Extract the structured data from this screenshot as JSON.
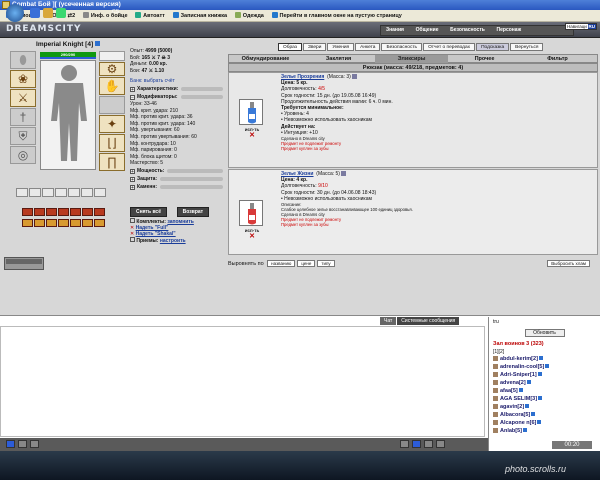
{
  "window": {
    "title": "Combat Бой ][ (усеченная версия)"
  },
  "toolbar": {
    "items": [
      "Помощь",
      "Окно ⇄2",
      "Инф. о бойце",
      "Автоатт",
      "Записная книжка",
      "Одежда",
      "Перейти в главном окне на пустую страницу"
    ]
  },
  "brand": {
    "logo": "DREAMSCITY"
  },
  "topnav": {
    "row1": [
      "Знания",
      "Общение",
      "Безопасность",
      "Персонаж"
    ],
    "row2": [
      "Инвентарь",
      "Умения",
      "Отчет о переводах",
      "Подсвенки",
      "Навигация"
    ],
    "nav_label": "Навигаци",
    "nav_value": "RU"
  },
  "character": {
    "name": "Imperial Knight",
    "level": "[4]",
    "hp": "290/290"
  },
  "stats": {
    "lines": [
      {
        "k": "Опыт:",
        "v": "4999 (5000)"
      },
      {
        "k": "Бой:",
        "v": "165 ⚔ 7 ☠ 3"
      },
      {
        "k": "Деньги:",
        "v": "0.00 кр."
      },
      {
        "k": "Бои:",
        "v": "47 ⚔ 1.10"
      }
    ],
    "bank": "Банк: выбрать счёт",
    "char_section": "Характеристики:",
    "mod_section": "Модификаторы:",
    "mods": [
      "Урон: 33-46",
      "Мф. крит. удара: 210",
      "Мф. против крит. удара: 36",
      "Мф. против крит. удара: 140",
      "Мф. увертывания: 60",
      "Мф. против увертывания: 60",
      "Мф. контрудара: 10",
      "Мф. парирования: 0",
      "Мф. блока щитом: 0",
      "Мастерство: 5"
    ],
    "sections2": [
      "Мощность:",
      "Защита:",
      "Каменн:"
    ],
    "btn_remove": "Снять всё",
    "btn_return": "Возврат",
    "comp_label": "Комплекты:",
    "comp_link": "запомнить",
    "sets": [
      "Надеть \"Full\"",
      "Надеть \"Shakal\""
    ],
    "tricks_label": "Приемы:",
    "tricks_link": "настроить"
  },
  "view_tabs": [
    "Образ",
    "Звери",
    "Умения",
    "Анкета",
    "Безопасность",
    "Отчет о переводах",
    "Подсказка",
    "Вернуться"
  ],
  "inv_tabs": [
    "Обмундирование",
    "Заклятия",
    "Эликсиры",
    "Прочее",
    "Фильтр"
  ],
  "backpack": "Рюкзак (масса: 49/218, предметов: 4)",
  "items": [
    {
      "name": "Зелье Прозрения",
      "mass": "(Масса: 3)",
      "price": "Цена: 5 кр.",
      "durability_label": "Долговечность:",
      "durability": "4/5",
      "expiry": "Срок годности: 15 дн. (до 19.05.08 16:49)",
      "duration": "Продолжительность действия магии: 6 ч. 0 мин.",
      "req_title": "Требуется минимальное:",
      "reqs": [
        "• Уровень: 4",
        "• Невозможно использовать хаосникам"
      ],
      "effect_title": "Действует на:",
      "effects": [
        "• Интуиция: +10"
      ],
      "made": "Сделано в Dreams city",
      "notes": [
        "Предмет не подлежит ремонту",
        "Предмет куплен за зубы"
      ],
      "use_label": "исп-ть"
    },
    {
      "name": "Зелье Жизни",
      "mass": "(Масса: 5)",
      "price": "Цена: 4 кр.",
      "durability_label": "Долговечность:",
      "durability": "9/10",
      "expiry": "Срок годности: 30 дн. (до 04.06.08 18:43)",
      "reqs": [
        "• Невозможно использовать хаосникам"
      ],
      "desc_title": "Описание:",
      "desc": "Слабое целебное зелье восстанавливающее 100 единиц здоровья.",
      "made": "Сделано в Dreams city",
      "notes": [
        "Предмет не подлежит ремонту",
        "Предмет куплен за зубы"
      ],
      "use_label": "исп-ть"
    }
  ],
  "align": {
    "label": "Выровнять по",
    "buttons": [
      "названию",
      "цене",
      "типу"
    ],
    "drop": "Выбросить хлам"
  },
  "chat": {
    "tabs": [
      "Чат",
      "Системные сообщения"
    ]
  },
  "users": {
    "header": "tru",
    "refresh": "Обновить",
    "room": "Зал воинов 3 (323)",
    "pages": "[1][2]",
    "list": [
      "abdul-kerim[2]",
      "adrenalin-cool[5]",
      "Adri-Sniper[1]",
      "advena[2]",
      "afaa[5]",
      "AGA SELIM[3]",
      "agavin[2]",
      "Albacora[5]",
      "Alcapone n[6]",
      "Anlab[5]"
    ]
  },
  "clock": "00:20",
  "taskbar": {
    "lang": "CS"
  },
  "watermark": "photo.scrolls.ru"
}
